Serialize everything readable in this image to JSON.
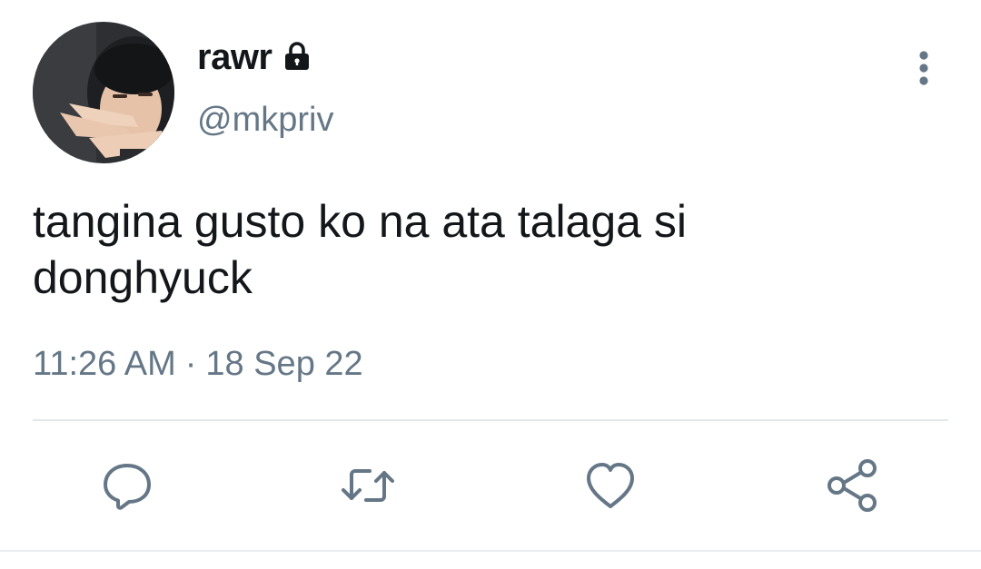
{
  "tweet": {
    "display_name": "rawr",
    "handle": "@mkpriv",
    "text": "tangina gusto ko na ata talaga si\ndonghyuck",
    "time": "11:26 AM",
    "separator": "·",
    "date": "18 Sep 22",
    "is_protected": true
  },
  "icons": {
    "lock": "lock-icon",
    "more": "more-options-icon",
    "reply": "reply-icon",
    "retweet": "retweet-icon",
    "like": "heart-icon",
    "share": "share-icon"
  },
  "colors": {
    "text_primary": "#14171a",
    "text_secondary": "#657786",
    "icon": "#657786",
    "divider": "#e1e8ed"
  }
}
